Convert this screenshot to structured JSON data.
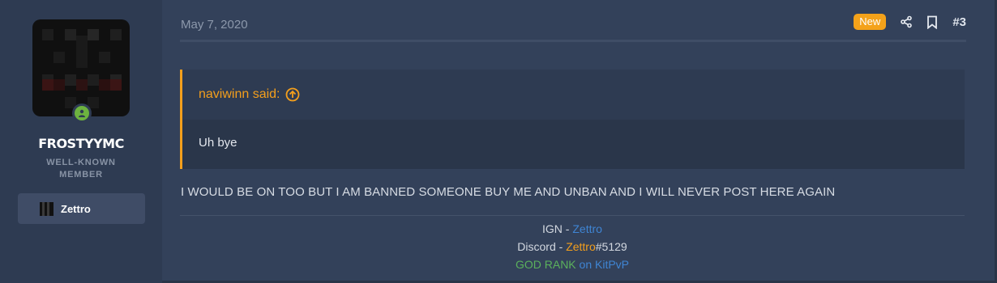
{
  "user": {
    "username": "FROSTYYMC",
    "title_line1": "WELL-KNOWN",
    "title_line2": "MEMBER",
    "banner_label": "Zettro",
    "avatar_icon": "pixel-skin-avatar",
    "online_icon": "online-user-icon"
  },
  "post": {
    "date": "May 7, 2020",
    "new_badge": "New",
    "number": "#3",
    "actions": [
      "share-icon",
      "bookmark-icon"
    ],
    "quote": {
      "author_said": "naviwinn said:",
      "text": "Uh bye",
      "jump_icon": "arrow-up-circle-icon"
    },
    "body": "I WOULD BE ON TOO BUT I AM BANNED SOMEONE BUY ME AND UNBAN AND I WILL NEVER POST HERE AGAIN"
  },
  "signature": {
    "ign_label": "IGN - ",
    "ign_value": "Zettro",
    "discord_label": "Discord - ",
    "discord_name": "Zettro",
    "discord_tag": "#5129",
    "rank": "GOD RANK",
    "rank_suffix": " on KitPvP"
  },
  "colors": {
    "accent_orange": "#f49f1c",
    "link_blue": "#3f85d4",
    "rank_green": "#5bb15c",
    "online_green": "#6db33f"
  }
}
